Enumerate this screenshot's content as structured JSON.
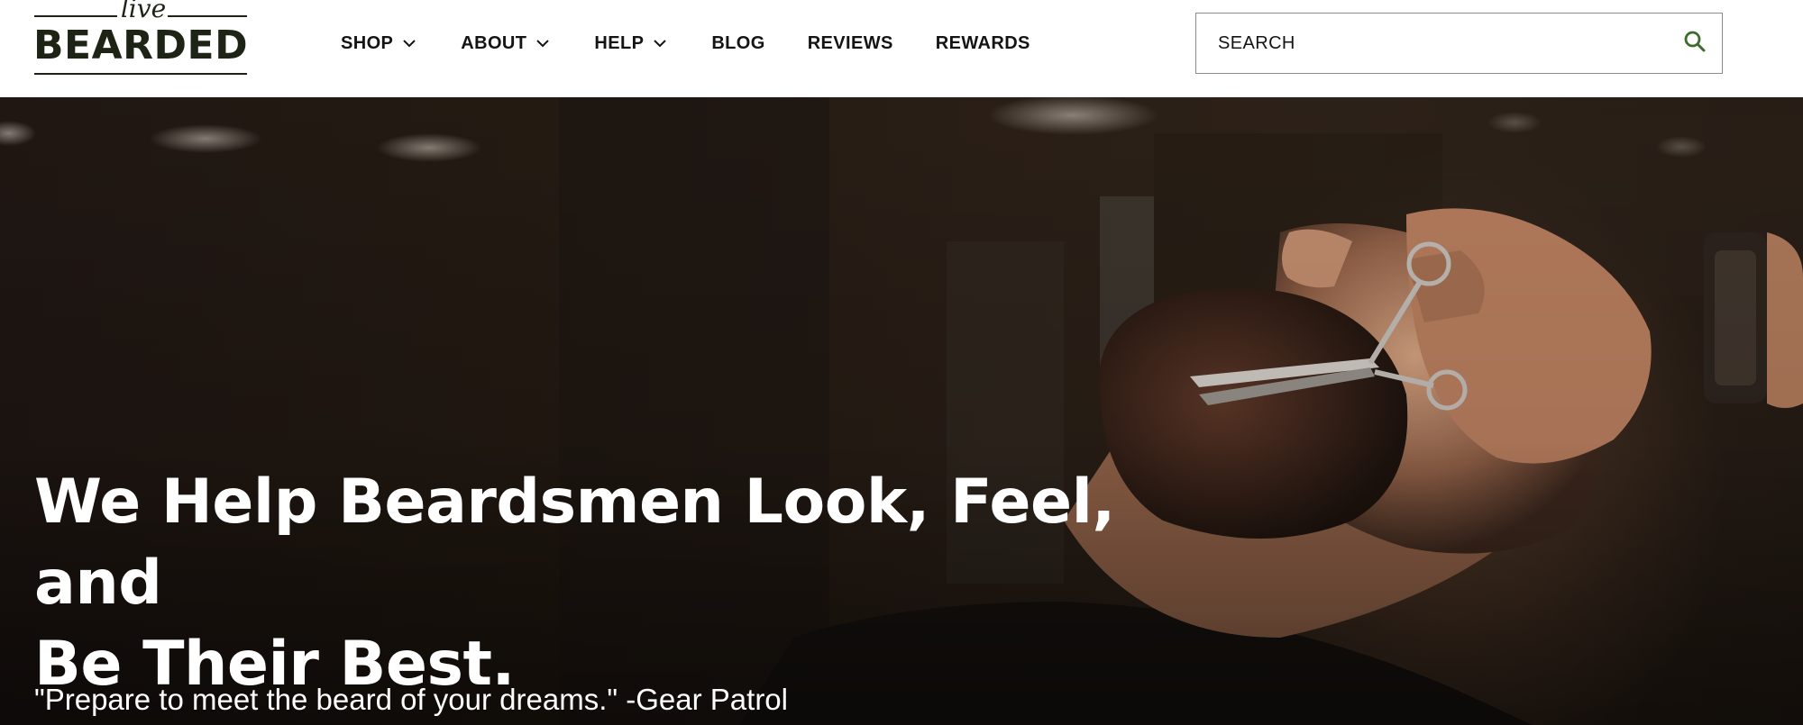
{
  "logo": {
    "script": "live",
    "word": "BEARDED"
  },
  "nav": {
    "items": [
      {
        "label": "SHOP",
        "has_dropdown": true
      },
      {
        "label": "ABOUT",
        "has_dropdown": true
      },
      {
        "label": "HELP",
        "has_dropdown": true
      },
      {
        "label": "BLOG",
        "has_dropdown": false
      },
      {
        "label": "REVIEWS",
        "has_dropdown": false
      },
      {
        "label": "REWARDS",
        "has_dropdown": false
      }
    ]
  },
  "search": {
    "placeholder": "SEARCH",
    "icon": "search-icon",
    "icon_color": "#3d6b2a"
  },
  "hero": {
    "title_line1": "We Help Beardsmen Look, Feel, and",
    "title_line2": "Be Their Best.",
    "quote": "\"Prepare to meet the beard of your dreams.\" -Gear Patrol"
  },
  "colors": {
    "brand": "#1d2415",
    "text": "#141414",
    "accent": "#3d6b2a",
    "hero_text": "#ffffff"
  }
}
